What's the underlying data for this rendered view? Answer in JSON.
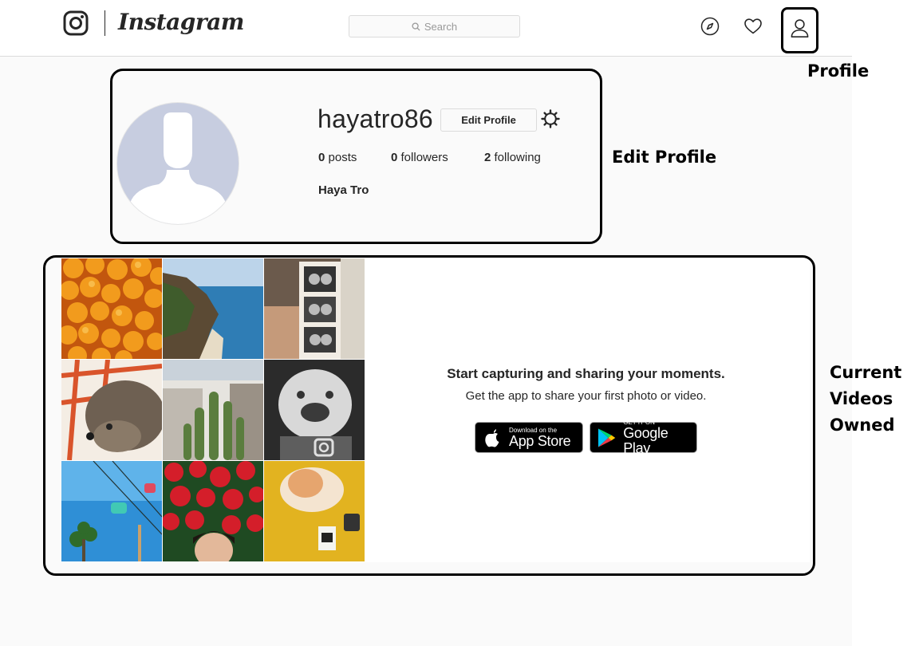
{
  "header": {
    "wordmark": "Instagram",
    "search_placeholder": "Search",
    "icons": [
      "instagram-glyph-icon",
      "compass-icon",
      "heart-icon",
      "person-icon"
    ]
  },
  "profile": {
    "username": "hayatro86",
    "edit_profile_label": "Edit Profile",
    "stats": [
      {
        "count": "0",
        "label": "posts"
      },
      {
        "count": "0",
        "label": "followers"
      },
      {
        "count": "2",
        "label": "following"
      }
    ],
    "full_name": "Haya Tro"
  },
  "posts_panel": {
    "cta_title": "Start capturing and sharing your moments.",
    "cta_subtitle": "Get the app to share your first photo or video.",
    "app_store": {
      "small": "Download on the",
      "big": "App Store"
    },
    "google_play": {
      "small": "GET IT ON",
      "big": "Google Play"
    },
    "sample_photos": [
      "oranges",
      "coastline",
      "photo-booth-strip",
      "curly-dog",
      "cactus-building",
      "laughing-baby",
      "gondola-sky-ride",
      "red-flowers-portrait",
      "cat-with-camera"
    ]
  },
  "annotations": {
    "profile": "Profile",
    "edit_profile": "Edit Profile",
    "current_videos": [
      "Current",
      "Videos",
      "Owned"
    ]
  },
  "colors": {
    "border": "#dbdbdb",
    "text": "#262626",
    "avatar_placeholder": "#c7cde0",
    "page_background": "#fafafa"
  }
}
